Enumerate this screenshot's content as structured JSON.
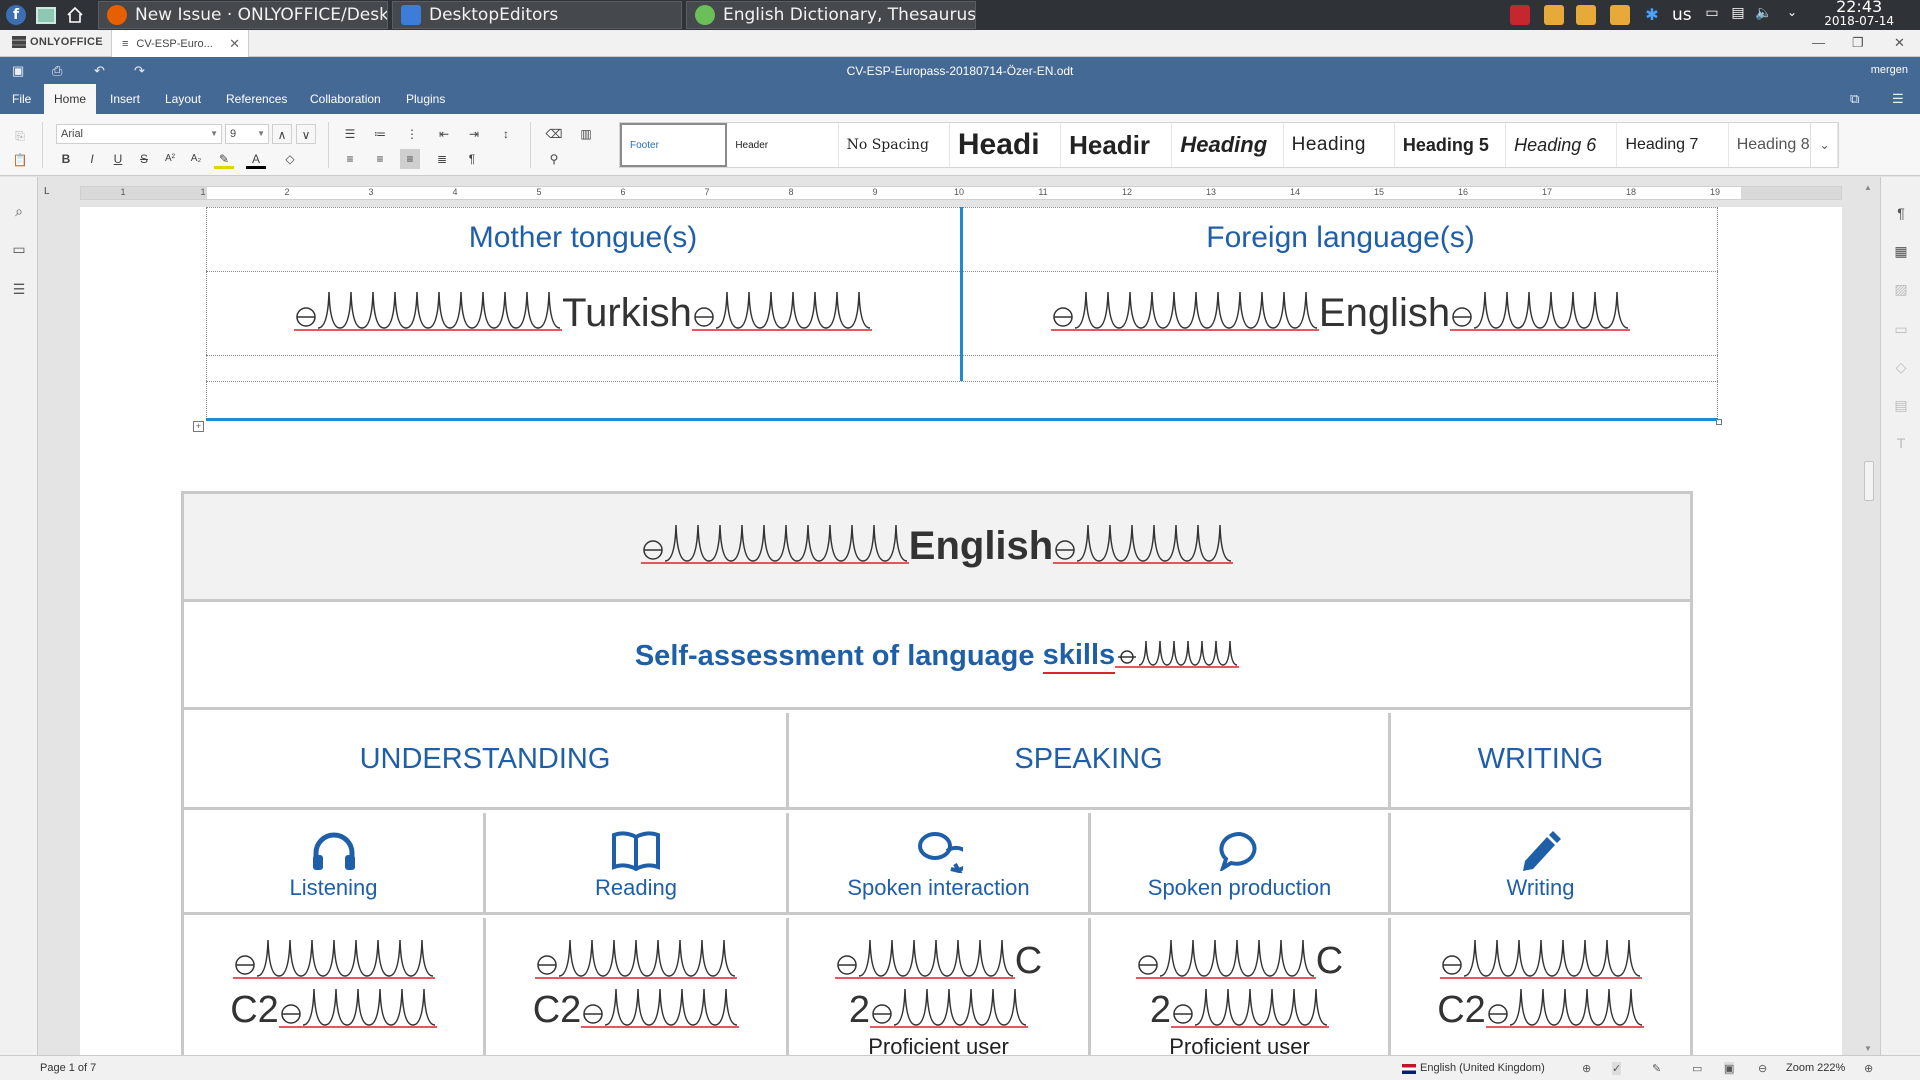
{
  "taskbar": {
    "tasks": [
      {
        "label": "New Issue · ONLYOFFICE/Desk...",
        "icon": "firefox-icon",
        "color": "#e66000"
      },
      {
        "label": "DesktopEditors",
        "icon": "layers-icon",
        "color": "#3b7dd8"
      },
      {
        "label": "English Dictionary, Thesaurus...",
        "icon": "globe-icon",
        "color": "#6bbf59"
      }
    ],
    "keyboard_layout": "us",
    "time": "22:43",
    "date": "2018-07-14"
  },
  "app": {
    "brand": "ONLYOFFICE",
    "doc_tab": "CV-ESP-Euro...",
    "doc_title": "CV-ESP-Europass-20180714-Özer-EN.odt",
    "user": "mergen"
  },
  "menu": {
    "tabs": [
      "File",
      "Home",
      "Insert",
      "Layout",
      "References",
      "Collaboration",
      "Plugins"
    ],
    "active": "Home"
  },
  "toolbar": {
    "font_name": "Arial",
    "font_size": "9"
  },
  "styles": [
    {
      "label": "Footer",
      "selected": true
    },
    {
      "label": "Header"
    },
    {
      "label": "No Spacing"
    },
    {
      "label": "Headi"
    },
    {
      "label": "Headir"
    },
    {
      "label": "Heading"
    },
    {
      "label": "Heading"
    },
    {
      "label": "Heading 5"
    },
    {
      "label": "Heading 6"
    },
    {
      "label": "Heading 7"
    },
    {
      "label": "Heading 8"
    }
  ],
  "ruler": {
    "numbers": [
      "1",
      "1",
      "2",
      "3",
      "4",
      "5",
      "6",
      "7",
      "8",
      "9",
      "10",
      "11",
      "12",
      "13",
      "14",
      "15",
      "16",
      "17",
      "18",
      "19"
    ]
  },
  "document": {
    "upper_table": {
      "col1_header": "Mother tongue(s)",
      "col2_header": "Foreign language(s)",
      "col1_value": "Turkish",
      "col2_value": "English"
    },
    "lang_table": {
      "language": "English",
      "subtitle_a": "Self-assessment of language ",
      "subtitle_b": "skills",
      "headers": [
        "UNDERSTANDING",
        "SPEAKING",
        "WRITING"
      ],
      "skills": [
        {
          "label": "Listening",
          "icon": "headphones-icon"
        },
        {
          "label": "Reading",
          "icon": "book-icon"
        },
        {
          "label": "Spoken interaction",
          "icon": "chat-bubbles-icon"
        },
        {
          "label": "Spoken production",
          "icon": "speech-bubble-icon"
        },
        {
          "label": "Writing",
          "icon": "pencil-icon"
        }
      ],
      "level_a": "C2",
      "level_b_c": "C",
      "level_b_2": "2",
      "proficient": "Proficient user"
    }
  },
  "status": {
    "page": "Page 1 of 7",
    "language": "English (United Kingdom)",
    "zoom": "Zoom 222%"
  },
  "colors": {
    "ribbon": "#446995",
    "heading_blue": "#1f5fa8",
    "table_border_blue": "#1e8bd1",
    "spell_underline": "#d8242a"
  }
}
